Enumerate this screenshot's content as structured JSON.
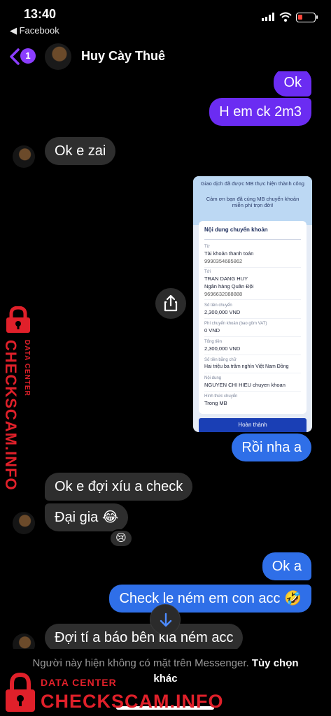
{
  "status_bar": {
    "time": "13:40",
    "back_app": "◀ Facebook"
  },
  "header": {
    "unread_count": "1",
    "contact_name": "Huy Cày Thuê"
  },
  "messages": [
    {
      "direction": "out",
      "text": "Ok"
    },
    {
      "direction": "out",
      "text": "H em ck 2m3"
    },
    {
      "direction": "in",
      "text": "Ok e zai"
    },
    {
      "direction": "out",
      "text": "Rồi nha a"
    },
    {
      "direction": "in",
      "text": "Ok e đợi xíu a check"
    },
    {
      "direction": "in",
      "text": "Đại gia 😂"
    },
    {
      "direction": "out",
      "text": "Ok a"
    },
    {
      "direction": "out",
      "text": "Check le ném em con acc 🤣"
    },
    {
      "direction": "in",
      "text": "Đợi tí a báo bên kia ném acc"
    }
  ],
  "reaction": "😢",
  "receipt": {
    "banner_line1": "Giao dịch đã được MB thực hiện thành công",
    "banner_line2": "Cảm ơn bạn đã cùng MB chuyển khoản miễn phí trọn đời!",
    "section_title": "Nội dung chuyển khoản",
    "from_label": "Từ",
    "from_account": "Tài khoản thanh toán",
    "from_number": "9990354685862",
    "to_label": "Tới",
    "to_name": "TRAN DANG HUY",
    "to_bank": "Ngân hàng Quân Đội",
    "to_number": "9696632088888",
    "amount_label": "Số tiền chuyển",
    "amount": "2,300,000 VND",
    "fee_label": "Phí chuyển khoản (bao gồm VAT)",
    "fee": "0 VND",
    "total_label": "Tổng tiền",
    "total": "2,300,000 VND",
    "words_label": "Số tiền bằng chữ",
    "words": "Hai triệu ba trăm nghìn Việt Nam Đồng",
    "content_label": "Nội dung",
    "content": "NGUYEN CHI HIEU chuyen khoan",
    "method_label": "Hình thức chuyển",
    "method": "Trong MB",
    "button": "Hoàn thành"
  },
  "footer": {
    "notice": "Người này hiện không có mặt trên Messenger.",
    "link": "Tùy chọn khác"
  },
  "watermark": {
    "sub": "DATA CENTER",
    "brand": "CHECKSCAM.INFO"
  },
  "colors": {
    "outgoing_bubble": "#6b2cf2",
    "outgoing_bubble_latest": "#2f6fe8",
    "incoming_bubble": "#2e2e2e",
    "accent": "#8b3dff",
    "watermark": "#e0202a"
  }
}
